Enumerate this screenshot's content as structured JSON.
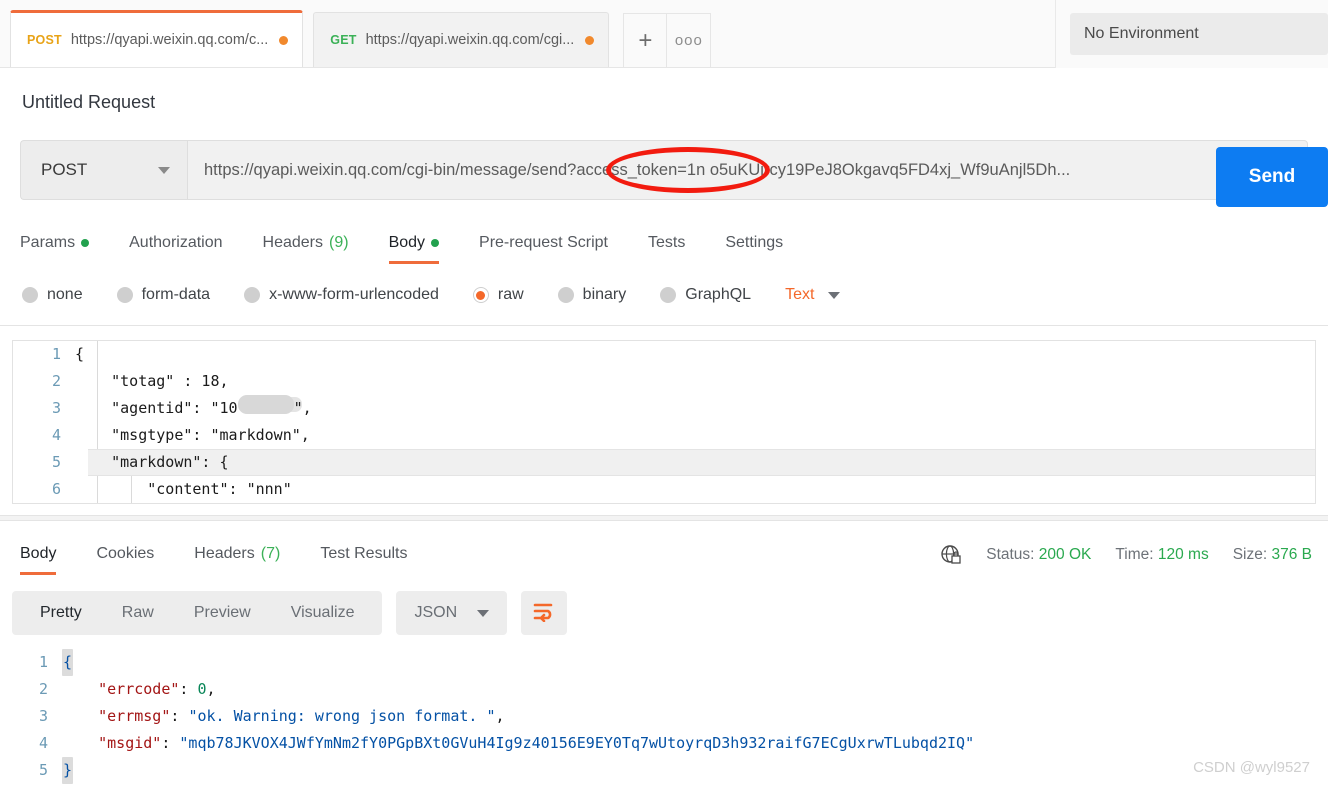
{
  "tabstrip": {
    "tabs": [
      {
        "method": "POST",
        "url": "https://qyapi.weixin.qq.com/c...",
        "dirty": true,
        "active": true
      },
      {
        "method": "GET",
        "url": "https://qyapi.weixin.qq.com/cgi...",
        "dirty": true,
        "active": false
      }
    ],
    "new_tab_label": "+",
    "more_label": "ooo",
    "environment": "No Environment"
  },
  "request": {
    "title": "Untitled Request",
    "method": "POST",
    "url": "https://qyapi.weixin.qq.com/cgi-bin/message/send?access_token=1n o5uKUjrcy19PeJ8Okgavq5FD4xj_Wf9uAnjl5Dh...",
    "send_label": "Send",
    "tabs": [
      {
        "label": "Params",
        "dot": true,
        "count": "",
        "active": false
      },
      {
        "label": "Authorization",
        "dot": false,
        "count": "",
        "active": false
      },
      {
        "label": "Headers",
        "dot": false,
        "count": "(9)",
        "active": false
      },
      {
        "label": "Body",
        "dot": true,
        "count": "",
        "active": true
      },
      {
        "label": "Pre-request Script",
        "dot": false,
        "count": "",
        "active": false
      },
      {
        "label": "Tests",
        "dot": false,
        "count": "",
        "active": false
      },
      {
        "label": "Settings",
        "dot": false,
        "count": "",
        "active": false
      }
    ],
    "body_types": [
      {
        "label": "none",
        "checked": false
      },
      {
        "label": "form-data",
        "checked": false
      },
      {
        "label": "x-www-form-urlencoded",
        "checked": false
      },
      {
        "label": "raw",
        "checked": true
      },
      {
        "label": "binary",
        "checked": false
      },
      {
        "label": "GraphQL",
        "checked": false
      }
    ],
    "raw_format": "Text",
    "body_lines": [
      {
        "n": "1",
        "text": "{"
      },
      {
        "n": "2",
        "text": "    \"totag\" : 18,"
      },
      {
        "n": "3",
        "text": "    \"agentid\": \"10"
      },
      {
        "n": "4",
        "text": "    \"msgtype\": \"markdown\","
      },
      {
        "n": "5",
        "text": "    \"markdown\": {"
      },
      {
        "n": "6",
        "text": "        \"content\": \"nnn\""
      }
    ],
    "body_line3_suffix": "\","
  },
  "response": {
    "tabs": [
      {
        "label": "Body",
        "count": "",
        "active": true
      },
      {
        "label": "Cookies",
        "count": "",
        "active": false
      },
      {
        "label": "Headers",
        "count": "(7)",
        "active": false
      },
      {
        "label": "Test Results",
        "count": "",
        "active": false
      }
    ],
    "status_label": "Status:",
    "status_value": "200 OK",
    "time_label": "Time:",
    "time_value": "120 ms",
    "size_label": "Size:",
    "size_value": "376 B",
    "view_modes": [
      {
        "label": "Pretty",
        "active": true
      },
      {
        "label": "Raw",
        "active": false
      },
      {
        "label": "Preview",
        "active": false
      },
      {
        "label": "Visualize",
        "active": false
      }
    ],
    "format": "JSON",
    "lines": [
      {
        "n": "1",
        "brace": "{"
      },
      {
        "n": "2",
        "key": "\"errcode\"",
        "sep": ": ",
        "num": "0",
        "tail": ","
      },
      {
        "n": "3",
        "key": "\"errmsg\"",
        "sep": ": ",
        "str": "\"ok. Warning: wrong json format. \"",
        "tail": ","
      },
      {
        "n": "4",
        "key": "\"msgid\"",
        "sep": ": ",
        "str": "\"mqb78JKVOX4JWfYmNm2fY0PGpBXt0GVuH4Ig9z40156E9EY0Tq7wUtoyrqD3h932raifG7ECgUxrwTLubqd2IQ\"",
        "tail": ""
      },
      {
        "n": "5",
        "brace": "}"
      }
    ]
  },
  "watermark": "CSDN @wyl9527",
  "colors": {
    "accent": "#ef6c3b",
    "send": "#0d7cf2",
    "success": "#2aa94f",
    "annotation": "#f21b0f",
    "post": "#e8a317",
    "get": "#3bb157"
  }
}
